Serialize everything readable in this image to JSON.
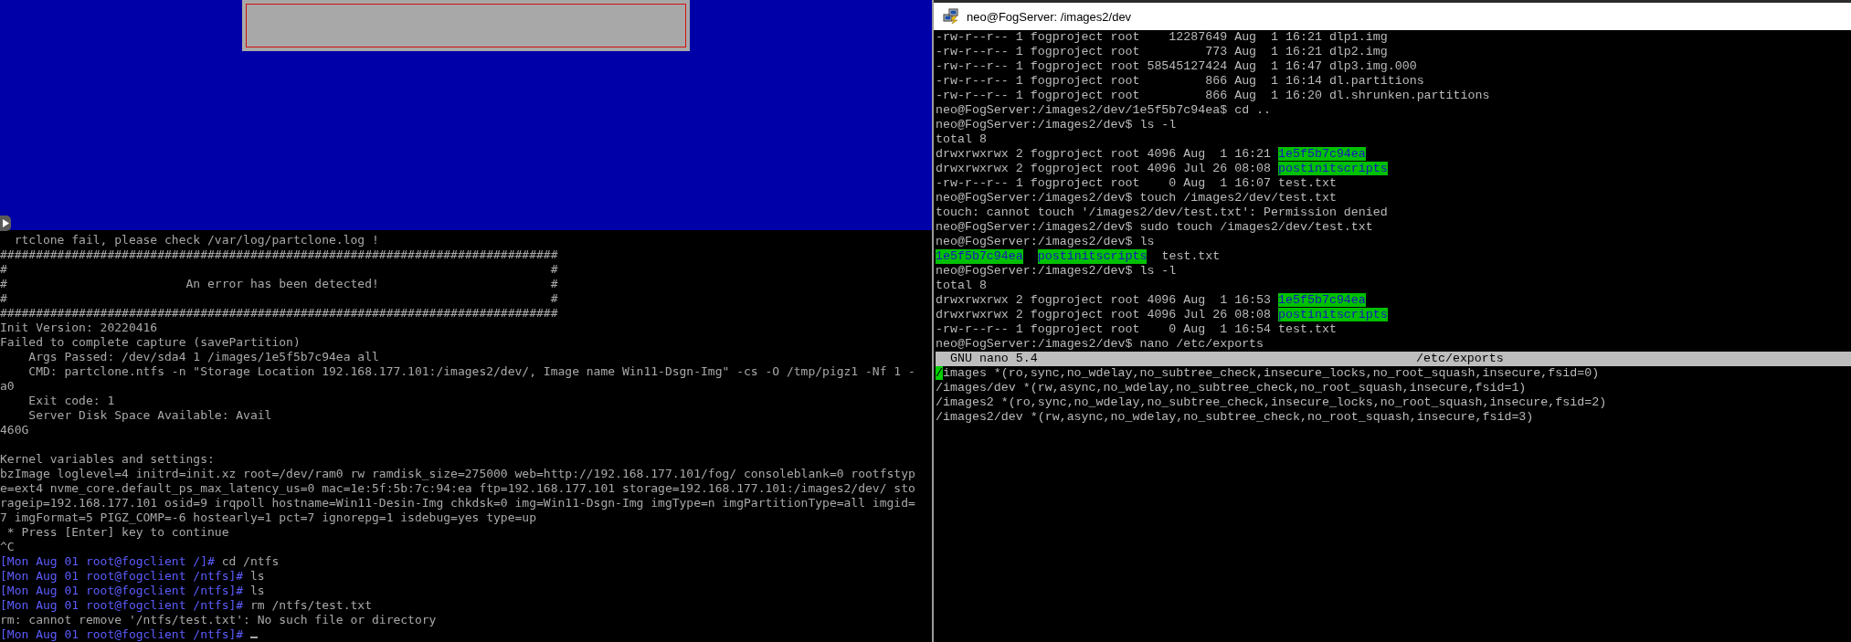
{
  "vm_console": {
    "lines": [
      {
        "text": "  rtclone fail, please check /var/log/partclone.log !"
      },
      {
        "text": "##############################################################################"
      },
      {
        "text": "#                                                                            #"
      },
      {
        "text": "#                         An error has been detected!                        #"
      },
      {
        "text": "#                                                                            #"
      },
      {
        "text": "##############################################################################"
      },
      {
        "text": "Init Version: 20220416"
      },
      {
        "text": "Failed to complete capture (savePartition)"
      },
      {
        "text": "    Args Passed: /dev/sda4 1 /images/1e5f5b7c94ea all"
      },
      {
        "text": "    CMD: partclone.ntfs -n \"Storage Location 192.168.177.101:/images2/dev/, Image name Win11-Dsgn-Img\" -cs -O /tmp/pigz1 -Nf 1 -"
      },
      {
        "text": "a0"
      },
      {
        "text": "    Exit code: 1"
      },
      {
        "text": "    Server Disk Space Available: Avail"
      },
      {
        "text": "460G"
      },
      {
        "kind": "blank"
      },
      {
        "text": "Kernel variables and settings:"
      },
      {
        "text": "bzImage loglevel=4 initrd=init.xz root=/dev/ram0 rw ramdisk_size=275000 web=http://192.168.177.101/fog/ consoleblank=0 rootfstyp"
      },
      {
        "text": "e=ext4 nvme_core.default_ps_max_latency_us=0 mac=1e:5f:5b:7c:94:ea ftp=192.168.177.101 storage=192.168.177.101:/images2/dev/ sto"
      },
      {
        "text": "rageip=192.168.177.101 osid=9 irqpoll hostname=Win11-Desin-Img chkdsk=0 img=Win11-Dsgn-Img imgType=n imgPartitionType=all imgid="
      },
      {
        "text": "7 imgFormat=5 PIGZ_COMP=-6 hostearly=1 pct=7 ignorepg=1 isdebug=yes type=up"
      },
      {
        "text": " * Press [Enter] key to continue"
      },
      {
        "text": "^C"
      },
      {
        "segments": [
          {
            "kind": "prompt",
            "text": "[Mon Aug 01 root@fogclient /]#"
          },
          {
            "kind": "plain",
            "text": " cd /ntfs"
          }
        ]
      },
      {
        "segments": [
          {
            "kind": "prompt",
            "text": "[Mon Aug 01 root@fogclient /ntfs]#"
          },
          {
            "kind": "plain",
            "text": " ls"
          }
        ]
      },
      {
        "segments": [
          {
            "kind": "prompt",
            "text": "[Mon Aug 01 root@fogclient /ntfs]#"
          },
          {
            "kind": "plain",
            "text": " ls"
          }
        ]
      },
      {
        "segments": [
          {
            "kind": "prompt",
            "text": "[Mon Aug 01 root@fogclient /ntfs]#"
          },
          {
            "kind": "plain",
            "text": " rm /ntfs/test.txt"
          }
        ]
      },
      {
        "text": "rm: cannot remove '/ntfs/test.txt': No such file or directory"
      },
      {
        "segments": [
          {
            "kind": "prompt",
            "text": "[Mon Aug 01 root@fogclient /ntfs]#"
          }
        ],
        "cursor": true
      }
    ]
  },
  "terminal": {
    "title": "neo@FogServer: /images2/dev",
    "lines": [
      {
        "text": "-rw-r--r-- 1 fogproject root    12287649 Aug  1 16:21 dlp1.img"
      },
      {
        "text": "-rw-r--r-- 1 fogproject root         773 Aug  1 16:21 dlp2.img"
      },
      {
        "text": "-rw-r--r-- 1 fogproject root 58545127424 Aug  1 16:47 dlp3.img.000"
      },
      {
        "text": "-rw-r--r-- 1 fogproject root         866 Aug  1 16:14 dl.partitions"
      },
      {
        "text": "-rw-r--r-- 1 fogproject root         866 Aug  1 16:20 dl.shrunken.partitions"
      },
      {
        "text": "neo@FogServer:/images2/dev/1e5f5b7c94ea$ cd .."
      },
      {
        "text": "neo@FogServer:/images2/dev$ ls -l"
      },
      {
        "text": "total 8"
      },
      {
        "segments": [
          {
            "kind": "plain",
            "text": "drwxrwxrwx 2 fogproject root 4096 Aug  1 16:21 "
          },
          {
            "kind": "dir",
            "text": "1e5f5b7c94ea"
          }
        ]
      },
      {
        "segments": [
          {
            "kind": "plain",
            "text": "drwxrwxrwx 2 fogproject root 4096 Jul 26 08:08 "
          },
          {
            "kind": "dir",
            "text": "postinitscripts"
          }
        ]
      },
      {
        "text": "-rw-r--r-- 1 fogproject root    0 Aug  1 16:07 test.txt"
      },
      {
        "text": "neo@FogServer:/images2/dev$ touch /images2/dev/test.txt"
      },
      {
        "text": "touch: cannot touch '/images2/dev/test.txt': Permission denied"
      },
      {
        "text": "neo@FogServer:/images2/dev$ sudo touch /images2/dev/test.txt"
      },
      {
        "text": "neo@FogServer:/images2/dev$ ls"
      },
      {
        "columns": [
          {
            "kind": "dir",
            "text": "1e5f5b7c94ea"
          },
          {
            "kind": "dir",
            "text": "postinitscripts"
          },
          {
            "kind": "plain",
            "text": "test.txt"
          }
        ]
      },
      {
        "text": "neo@FogServer:/images2/dev$ ls -l"
      },
      {
        "text": "total 8"
      },
      {
        "segments": [
          {
            "kind": "plain",
            "text": "drwxrwxrwx 2 fogproject root 4096 Aug  1 16:53 "
          },
          {
            "kind": "dir",
            "text": "1e5f5b7c94ea"
          }
        ]
      },
      {
        "segments": [
          {
            "kind": "plain",
            "text": "drwxrwxrwx 2 fogproject root 4096 Jul 26 08:08 "
          },
          {
            "kind": "dir",
            "text": "postinitscripts"
          }
        ]
      },
      {
        "text": "-rw-r--r-- 1 fogproject root    0 Aug  1 16:54 test.txt"
      },
      {
        "text": "neo@FogServer:/images2/dev$ nano /etc/exports"
      }
    ],
    "nano": {
      "version": "GNU nano 5.4",
      "filename": "/etc/exports",
      "lines": [
        {
          "segments": [
            {
              "kind": "cursor",
              "text": "/"
            },
            {
              "kind": "plain",
              "text": "images *(ro,sync,no_wdelay,no_subtree_check,insecure_locks,no_root_squash,insecure,fsid=0)"
            }
          ]
        },
        {
          "text": "/images/dev *(rw,async,no_wdelay,no_subtree_check,no_root_squash,insecure,fsid=1)"
        },
        {
          "text": "/images2 *(ro,sync,no_wdelay,no_subtree_check,insecure_locks,no_root_squash,insecure,fsid=2)"
        },
        {
          "text": "/images2/dev *(rw,async,no_wdelay,no_subtree_check,no_root_squash,insecure,fsid=3)"
        }
      ]
    }
  }
}
